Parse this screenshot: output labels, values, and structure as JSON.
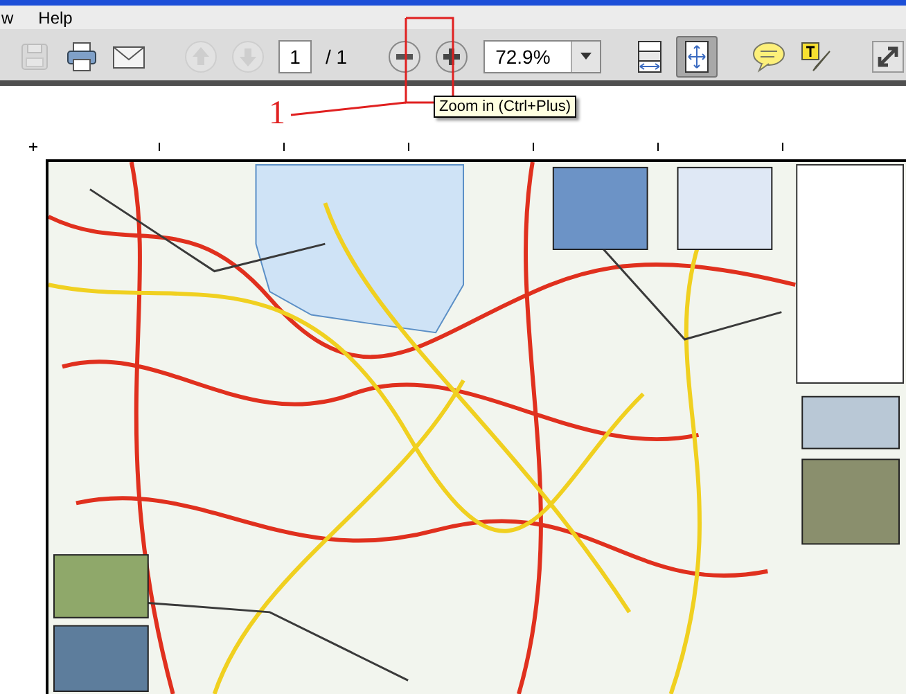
{
  "menu": [
    {
      "label": "w"
    },
    {
      "label": "Help"
    }
  ],
  "toolbar": [
    {
      "kind": "save",
      "disabled": true,
      "pressed": false
    },
    {
      "kind": "print",
      "disabled": false,
      "pressed": false
    },
    {
      "kind": "email",
      "disabled": false,
      "pressed": false
    },
    {
      "kind": "separator"
    },
    {
      "kind": "prev",
      "disabled": true,
      "pressed": false
    },
    {
      "kind": "next",
      "disabled": true,
      "pressed": false
    },
    {
      "kind": "page",
      "value": "1",
      "total": "/ 1"
    },
    {
      "kind": "separator"
    },
    {
      "kind": "zoomout",
      "disabled": false,
      "pressed": false
    },
    {
      "kind": "zoomin",
      "disabled": false,
      "pressed": false
    },
    {
      "kind": "zoom",
      "value": "72.9%"
    },
    {
      "kind": "separator"
    },
    {
      "kind": "fitwidth",
      "disabled": false,
      "pressed": false
    },
    {
      "kind": "fitpage",
      "disabled": false,
      "pressed": true
    },
    {
      "kind": "separator"
    },
    {
      "kind": "comment",
      "disabled": false,
      "pressed": false
    },
    {
      "kind": "highlight",
      "disabled": false,
      "pressed": false
    },
    {
      "kind": "separator"
    },
    {
      "kind": "fullscreen",
      "disabled": false,
      "pressed": false
    }
  ],
  "tooltip": "Zoom in (Ctrl+Plus)",
  "callout": {
    "number": "1"
  }
}
